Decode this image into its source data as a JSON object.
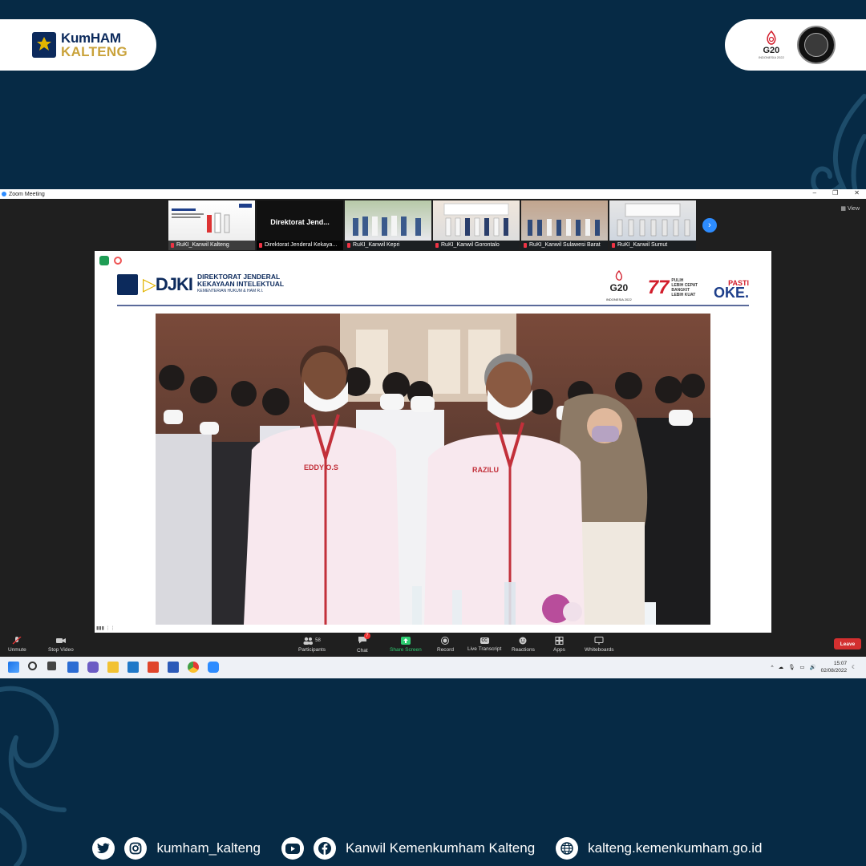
{
  "header": {
    "brand_line1": "KumHAM",
    "brand_line2": "KALTENG",
    "g20_label": "G20",
    "g20_sub": "INDONESIA 2022"
  },
  "zoom": {
    "window_title": "Zoom Meeting",
    "view_label": "View",
    "thumbnails": [
      {
        "label": "RuKI_Kanwil Kalteng",
        "kind": "slide"
      },
      {
        "label": "Direktorat Jenderal Kekaya...",
        "kind": "name",
        "display_name": "Direktorat Jend..."
      },
      {
        "label": "RuKI_Kanwil Kepri",
        "kind": "video"
      },
      {
        "label": "RuKI_Kanwil Gorontalo",
        "kind": "video"
      },
      {
        "label": "RuKI_Kanwil Sulawesi Barat",
        "kind": "video"
      },
      {
        "label": "RuKI_Kanwil Sumut",
        "kind": "video"
      }
    ],
    "slide": {
      "org_mark": "DJKI",
      "org_line1": "DIREKTORAT JENDERAL",
      "org_line2": "KEKAYAAN INTELEKTUAL",
      "org_line3": "KEMENTERIAN HUKUM & HAM R.I.",
      "g20": "G20",
      "g20_sub": "INDONESIA 2022",
      "anniv_num": "77",
      "anniv_l1": "PULIH",
      "anniv_l2": "LEBIH CEPAT",
      "anniv_l3": "BANGKIT",
      "anniv_l4": "LEBIH KUAT",
      "pasti": "PASTI",
      "oke": "OKE.",
      "shirt_left": "EDDY O.S",
      "shirt_right": "RAZILU"
    },
    "toolbar": {
      "unmute": "Unmute",
      "stop_video": "Stop Video",
      "participants": "Participants",
      "participants_count": "58",
      "chat": "Chat",
      "chat_badge": "7",
      "share_screen": "Share Screen",
      "record": "Record",
      "live_transcript": "Live Transcript",
      "cc": "CC",
      "reactions": "Reactions",
      "apps": "Apps",
      "whiteboards": "Whiteboards",
      "leave": "Leave"
    },
    "taskbar": {
      "time": "15:07",
      "date": "02/08/2022"
    }
  },
  "footer": {
    "instagram": "kumham_kalteng",
    "facebook": "Kanwil Kemenkumham Kalteng",
    "website": "kalteng.kemenkumham.go.id"
  },
  "colors": {
    "background": "#062a45",
    "brand_navy": "#0c2a5c",
    "brand_gold": "#c9a23a",
    "zoom_blue": "#2d8cff",
    "leave_red": "#d32f2f"
  }
}
